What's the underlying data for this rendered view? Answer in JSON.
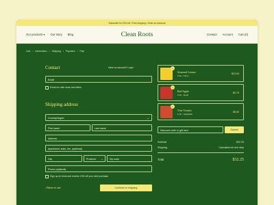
{
  "banner": {
    "text": "Subscribe for 15% off • Free shipping • Enter at checkout"
  },
  "topnav": {
    "left": [
      "Our products ▾",
      "Our story",
      "Blog"
    ],
    "brand": "Clean Roots",
    "right": [
      "Contact",
      "Account",
      "Cart (0)"
    ]
  },
  "breadcrumbs": [
    "Cart",
    "›",
    "Information",
    "›",
    "Shipping",
    "›",
    "Payment",
    "›",
    "Pay!"
  ],
  "contact": {
    "title": "Contact",
    "have_account": "Have an account?",
    "login": "Login",
    "email_placeholder": "Email",
    "email_opt": "Email me with news and offers"
  },
  "shipping": {
    "title": "Shipping address",
    "country": "Country/region",
    "first": "First name",
    "last": "Last name",
    "address": "Address",
    "apartment": "Apartment, suite, etc. (optional)",
    "city": "City",
    "province": "Province",
    "zip": "Zip code",
    "phone": "Phone (optional)",
    "sms_opt": "Sign up for texts and receive 10% off your next purchase",
    "return_link": "‹ Return to cart",
    "continue": "Continue to shipping"
  },
  "items": [
    {
      "badge": "1",
      "title": "Seasonal Lemon",
      "sub": "Fruit - Citrus",
      "price": "$10.00",
      "color": "#f0cf2f"
    },
    {
      "badge": "1",
      "title": "Red Apple",
      "sub": "Fruit - Apple",
      "price": "$3.75",
      "color": "#c8352a"
    },
    {
      "badge": "1",
      "title": "Vine Tomato",
      "sub": "Fruit - Vegetable",
      "price": "$5.50",
      "color": "#d14b2f"
    }
  ],
  "discount": {
    "placeholder": "Discount code or gift card",
    "submit": "Submit"
  },
  "totals": {
    "subtotal_label": "Subtotal",
    "subtotal": "$32.25",
    "shipping_label": "Shipping",
    "shipping": "Calculated at next step",
    "total_label": "Total",
    "total": "$32.25"
  },
  "colors": {
    "bg": "#1e5a1f",
    "accent": "#f5e87a",
    "banner": "#f5e87a"
  }
}
